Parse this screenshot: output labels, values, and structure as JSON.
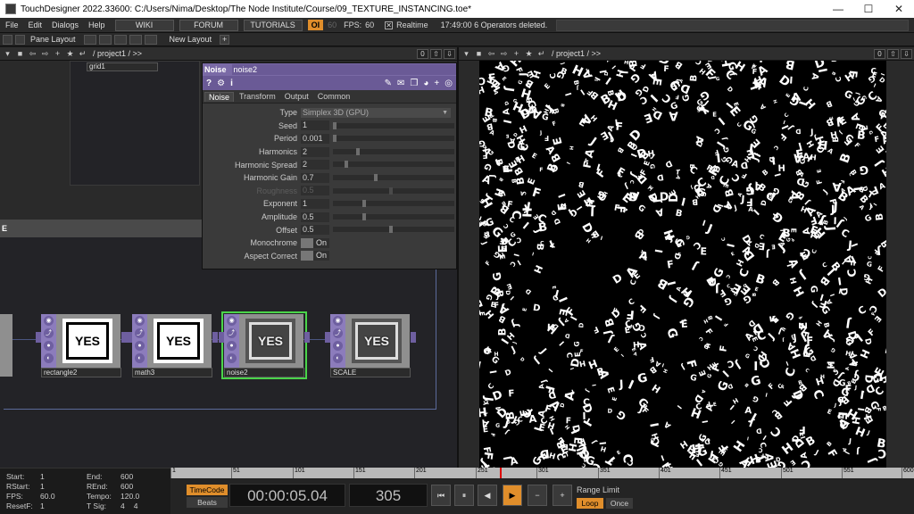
{
  "window": {
    "title": "TouchDesigner 2022.33600: C:/Users/Nima/Desktop/The Node Institute/Course/09_TEXTURE_INSTANCING.toe*",
    "minimize": "—",
    "maximize": "☐",
    "close": "✕"
  },
  "menu": {
    "items": [
      "File",
      "Edit",
      "Dialogs",
      "Help"
    ],
    "wiki": "WIKI",
    "forum": "FORUM",
    "tutorials": "TUTORIALS",
    "oi_badge": "OI",
    "fps_dim": "60",
    "fps_label": "FPS:",
    "fps_value": "60",
    "realtime_label": "Realtime",
    "status": "17:49:00 6 Operators deleted."
  },
  "layoutbar": {
    "pane_layout": "Pane Layout",
    "new_layout": "New Layout",
    "plus": "+"
  },
  "left_pane": {
    "path": "/ project1 / >>",
    "box0": "0"
  },
  "right_pane": {
    "path": "/ project1 / >>",
    "box0": "0"
  },
  "network": {
    "grid_label": "grid1",
    "nodes": [
      {
        "name": "rectangle2",
        "label": "YES"
      },
      {
        "name": "math3",
        "label": "YES"
      },
      {
        "name": "noise2",
        "label": "YES"
      },
      {
        "name": "SCALE",
        "label": "YES"
      }
    ],
    "left_edge_label": "E"
  },
  "params": {
    "op_type": "Noise",
    "op_name": "noise2",
    "info_icon": "i",
    "help_icon": "?",
    "tabs": [
      "Noise",
      "Transform",
      "Output",
      "Common"
    ],
    "type_label": "Type",
    "type_value": "Simplex 3D (GPU)",
    "rows": [
      {
        "label": "Seed",
        "value": "1",
        "pos": 0.0
      },
      {
        "label": "Period",
        "value": "0.001",
        "pos": 0.0
      },
      {
        "label": "Harmonics",
        "value": "2",
        "pos": 0.2
      },
      {
        "label": "Harmonic Spread",
        "value": "2",
        "pos": 0.1
      },
      {
        "label": "Harmonic Gain",
        "value": "0.7",
        "pos": 0.35
      },
      {
        "label": "Roughness",
        "value": "0.5",
        "pos": 0.48,
        "disabled": true
      },
      {
        "label": "Exponent",
        "value": "1",
        "pos": 0.25
      },
      {
        "label": "Amplitude",
        "value": "0.5",
        "pos": 0.25
      },
      {
        "label": "Offset",
        "value": "0.5",
        "pos": 0.48
      }
    ],
    "monochrome_label": "Monochrome",
    "monochrome_value": "On",
    "aspect_label": "Aspect Correct",
    "aspect_value": "On"
  },
  "bottom": {
    "start_k": "Start:",
    "start_v": "1",
    "rstart_k": "RStart:",
    "rstart_v": "1",
    "fps_k": "FPS:",
    "fps_v": "60.0",
    "resetf_k": "ResetF:",
    "resetf_v": "1",
    "end_k": "End:",
    "end_v": "600",
    "rend_k": "REnd:",
    "rend_v": "600",
    "tempo_k": "Tempo:",
    "tempo_v": "120.0",
    "tsig_k": "T Sig:",
    "tsig_v1": "4",
    "tsig_v2": "4",
    "ticks": [
      "1",
      "51",
      "101",
      "151",
      "201",
      "251",
      "301",
      "351",
      "401",
      "451",
      "501",
      "551",
      "600"
    ],
    "timecode": "TimeCode",
    "beats": "Beats",
    "time": "00:00:05.04",
    "frame": "305",
    "transport": [
      "⏮",
      "⏸",
      "◀",
      "▶",
      "−",
      "+"
    ],
    "range_limit": "Range Limit",
    "loop": "Loop",
    "once": "Once"
  },
  "viewer": {
    "letters": "ABCDEFGHIJ"
  }
}
